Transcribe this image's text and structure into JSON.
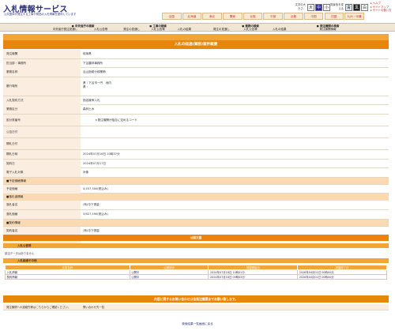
{
  "header": {
    "logo": "入札情報サービス",
    "logo_sub": "公共団体が発注する工事や物品の入札情報を提供しています",
    "size_label": "文字の大きさ：",
    "size_buttons": [
      "大",
      "中",
      "小"
    ],
    "color_label": "背景色を変える",
    "color_buttons": [
      "青",
      "黒",
      "白"
    ],
    "help": [
      "ヘルプ",
      "サイトマップ",
      "サイトの使い方"
    ]
  },
  "regions": [
    "全国",
    "北海道",
    "東北",
    "関東",
    "北陸",
    "中部",
    "近畿",
    "中国",
    "四国",
    "九州・沖縄"
  ],
  "tabs": [
    {
      "title": "中央省庁の検索",
      "subs": [
        "中央省庁発注見通し",
        "入札公告等"
      ]
    },
    {
      "title": "工事の検索",
      "subs": [
        "発注の見通し",
        "入札公告等",
        "入札の結果"
      ]
    },
    {
      "title": "業務の検索",
      "subs": [
        "発注の見通し",
        "入札公告等",
        "入札の結果"
      ]
    },
    {
      "title": "発注機関の検索",
      "subs": [
        "発注機関情報"
      ]
    }
  ],
  "page_title": "入札の経過(業務)案件概要",
  "fields": [
    {
      "label": "発注機関",
      "value": "岐阜県"
    },
    {
      "label": "担当部・事務所",
      "value": "下呂農林事務所"
    },
    {
      "label": "業務名称",
      "value": "治山指助分検業節"
    },
    {
      "label": "履行場所",
      "value": "県・下呂市一円　地内\n県・"
    },
    {
      "label": "入札契約方式",
      "value": "指名競争入札"
    },
    {
      "label": "業務区分",
      "value": "森林土木"
    },
    {
      "label": "設計書番号",
      "value": "＊発注機関が独自に定めるコード"
    },
    {
      "label": "公告日付",
      "value": ""
    },
    {
      "label": "開札日付",
      "value": ""
    },
    {
      "label": "開札日時",
      "value": "2024年07月16日 10時37分"
    },
    {
      "label": "契約日",
      "value": "2024年07月17日"
    },
    {
      "label": "電子入札対象",
      "value": "対象"
    },
    {
      "label": "■予定価格情報",
      "value": ""
    },
    {
      "label": "予定価格",
      "value": "4,557,300(税込み)"
    },
    {
      "label": "■落札者情報",
      "value": ""
    },
    {
      "label": "落札者名",
      "value": "(有)中下測量"
    },
    {
      "label": "落札価格",
      "value": "3,627,590(税込み)"
    },
    {
      "label": "■契約情報",
      "value": ""
    },
    {
      "label": "契約者名",
      "value": "(有)中下測量"
    },
    {
      "label": "契約金額",
      "value": "3,627,590(税込み)"
    }
  ],
  "public": {
    "bar": "公開文書",
    "notice_title": "入札公告等",
    "notice_empty": "該当データはありません",
    "other_title": "入札経過その他",
    "table_headers": [
      "文書名称",
      "公開状況",
      "掲載開始日",
      "掲載終了日"
    ],
    "table_rows": [
      [
        "入札情報",
        "公開中",
        "2024年07月18日 10時41分",
        "2026年04月01日 00時00分"
      ],
      [
        "契約情報",
        "公開中",
        "2024年07月18日 09時43分",
        "2026年04月01日 00時00分"
      ]
    ]
  },
  "inquiry": {
    "bar": "内容に関するお問い合わせは各発注機関までお願い致します。",
    "label": "発注機関への連絡先等はこちらからご確認ください。",
    "link": "問い合わせ先一覧"
  },
  "back_link": "検索結果一覧画面に戻る"
}
